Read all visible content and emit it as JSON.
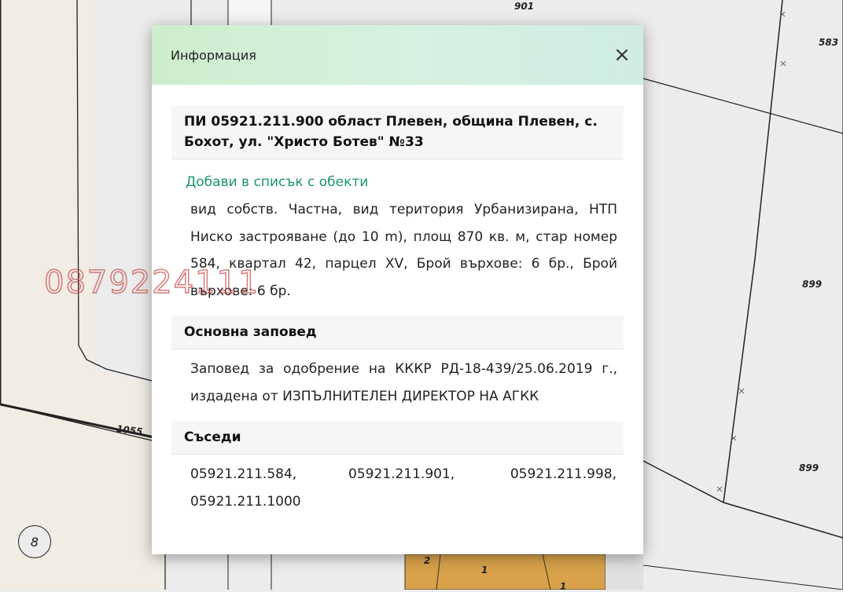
{
  "map": {
    "labels": [
      "901",
      "583",
      "899",
      "899",
      "1055",
      "2",
      "1",
      "1"
    ],
    "circle_label": "8",
    "watermark": "0879224111"
  },
  "dialog": {
    "title": "Информация",
    "close_symbol": "×",
    "parcel_title": "ПИ 05921.211.900 област Плевен, община Плевен, с. Бохот, ул. \"Христо Ботев\" №33",
    "add_link": "Добави в списък с обекти",
    "description": "вид собств. Частна, вид територия Урбанизирана, НТП Ниско застрояване (до 10 m), площ 870 кв. м, стар номер 584, квартал 42, парцел XV, Брой върхове: 6 бр., Брой върхове: 6 бр.",
    "order_heading": "Основна заповед",
    "order_text": "Заповед за одобрение на КККР РД-18-439/25.06.2019 г., издадена от ИЗПЪЛНИТЕЛЕН ДИРЕКТОР НА АГКК",
    "neighbors_heading": "Съседи",
    "neighbors": [
      "05921.211.584,",
      "05921.211.901,",
      "05921.211.998,",
      "05921.211.1000"
    ]
  },
  "colors": {
    "link": "#1a9668",
    "header_gradient_start": "#cdeecd",
    "header_gradient_end": "#cfece3"
  }
}
